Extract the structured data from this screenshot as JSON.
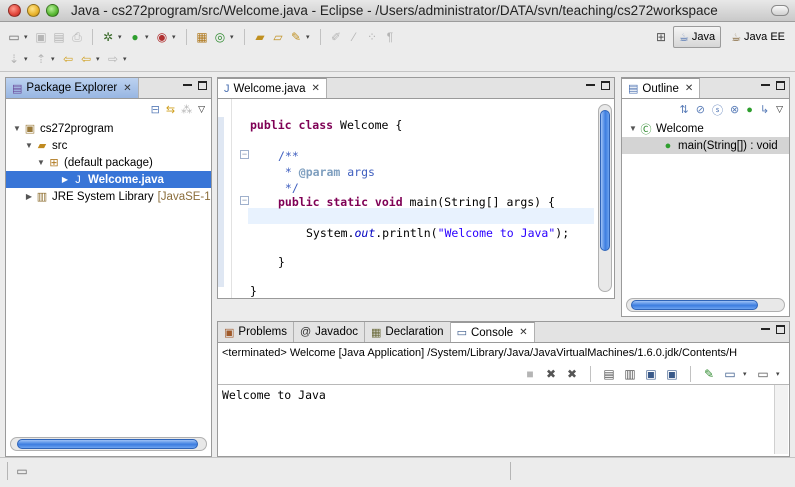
{
  "window": {
    "title": "Java - cs272program/src/Welcome.java - Eclipse - /Users/administrator/DATA/svn/teaching/cs272workspace"
  },
  "toolbar": {
    "row1": [
      "new-icon",
      "save-icon",
      "save-all-icon",
      "print-icon",
      "debug-icon",
      "run-icon",
      "run-external-icon",
      "new-java-project-icon",
      "new-class-icon",
      "open-type-icon",
      "search-icon",
      "open-task-icon",
      "toggle-mark-icon",
      "toggle-block-icon",
      "show-whitespace-icon",
      "pilcrow-icon"
    ],
    "row2": [
      "next-annotation-icon",
      "prev-annotation-icon",
      "last-edit-icon",
      "back-icon",
      "forward-icon"
    ]
  },
  "perspectives": [
    {
      "label": "Java",
      "active": true
    },
    {
      "label": "Java EE",
      "active": false
    }
  ],
  "package_explorer": {
    "tab_label": "Package Explorer",
    "tree": [
      {
        "label": "cs272program",
        "indent": 0,
        "icon": "project"
      },
      {
        "label": "src",
        "indent": 1,
        "icon": "folder"
      },
      {
        "label": "(default package)",
        "indent": 2,
        "icon": "package"
      },
      {
        "label": "Welcome.java",
        "indent": 3,
        "icon": "java-file",
        "selected": true
      },
      {
        "label": "JRE System Library",
        "suffix": "[JavaSE-1",
        "indent": 1,
        "icon": "library"
      }
    ]
  },
  "editor": {
    "tab_label": "Welcome.java",
    "lines": {
      "l1_kw": "public class",
      "l1_rest": " Welcome {",
      "l3": "/**",
      "l4_pre": " * ",
      "l4_tag": "@param",
      "l4_rest": " args",
      "l5": " */",
      "l6_kw": "public static void",
      "l6_rest": " main(String[] args) {",
      "l8_pre": "System.",
      "l8_it": "out",
      "l8_mid": ".println(",
      "l8_str": "\"Welcome to Java\"",
      "l8_end": ");",
      "l10": "}",
      "l12": "}"
    }
  },
  "outline": {
    "tab_label": "Outline",
    "items": [
      {
        "label": "Welcome"
      },
      {
        "label": "main(String[]) : void",
        "selected": true
      }
    ]
  },
  "bottom_tabs": [
    {
      "label": "Problems"
    },
    {
      "label": "Javadoc"
    },
    {
      "label": "Declaration"
    },
    {
      "label": "Console",
      "active": true
    }
  ],
  "console": {
    "status": "<terminated> Welcome [Java Application] /System/Library/Java/JavaVirtualMachines/1.6.0.jdk/Contents/H",
    "output": "Welcome to Java"
  }
}
